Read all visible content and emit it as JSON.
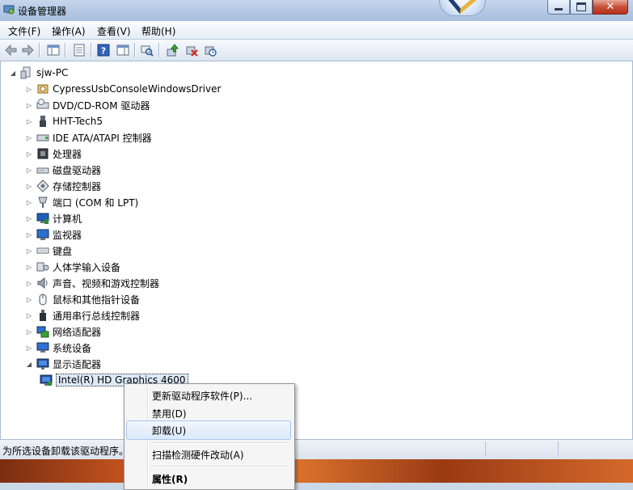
{
  "window": {
    "title": "设备管理器"
  },
  "menubar": [
    "文件(F)",
    "操作(A)",
    "查看(V)",
    "帮助(H)"
  ],
  "tree": {
    "root": "sjw-PC",
    "items": [
      {
        "label": "CypressUsbConsoleWindowsDriver",
        "icon": "usb-driver-icon"
      },
      {
        "label": "DVD/CD-ROM 驱动器",
        "icon": "dvd-drive-icon"
      },
      {
        "label": "HHT-Tech5",
        "icon": "usb-plug-icon"
      },
      {
        "label": "IDE ATA/ATAPI 控制器",
        "icon": "ide-controller-icon"
      },
      {
        "label": "处理器",
        "icon": "processor-icon"
      },
      {
        "label": "磁盘驱动器",
        "icon": "disk-drive-icon"
      },
      {
        "label": "存储控制器",
        "icon": "storage-controller-icon"
      },
      {
        "label": "端口 (COM 和 LPT)",
        "icon": "port-icon"
      },
      {
        "label": "计算机",
        "icon": "computer-icon"
      },
      {
        "label": "监视器",
        "icon": "monitor-icon"
      },
      {
        "label": "键盘",
        "icon": "keyboard-icon"
      },
      {
        "label": "人体学输入设备",
        "icon": "hid-icon"
      },
      {
        "label": "声音、视频和游戏控制器",
        "icon": "speaker-icon"
      },
      {
        "label": "鼠标和其他指针设备",
        "icon": "mouse-icon"
      },
      {
        "label": "通用串行总线控制器",
        "icon": "usb-controller-icon"
      },
      {
        "label": "网络适配器",
        "icon": "network-adapter-icon"
      },
      {
        "label": "系统设备",
        "icon": "system-device-icon"
      },
      {
        "label": "显示适配器",
        "icon": "display-adapter-icon",
        "expanded": true
      }
    ],
    "child": {
      "label": "Intel(R) HD Graphics 4600",
      "icon": "display-adapter-icon"
    }
  },
  "context_menu": [
    {
      "label": "更新驱动程序软件(P)..."
    },
    {
      "label": "禁用(D)"
    },
    {
      "label": "卸载(U)",
      "highlighted": true
    },
    {
      "label": "扫描检测硬件改动(A)"
    },
    {
      "label": "属性(R)",
      "bold": true
    }
  ],
  "statusbar": {
    "text": "为所选设备卸载该驱动程序。"
  }
}
